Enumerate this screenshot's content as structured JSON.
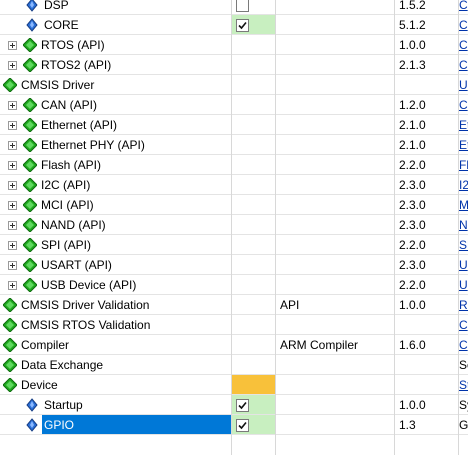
{
  "rows": [
    {
      "id": "dsp",
      "name": "DSP",
      "indent": 2,
      "icon": "component",
      "expander": false,
      "sel": "checkbox-off",
      "variant": "",
      "version": "1.5.2",
      "desc": "C",
      "link": true
    },
    {
      "id": "core",
      "name": "CORE",
      "indent": 2,
      "icon": "component",
      "expander": false,
      "sel": "checkbox-on-green",
      "variant": "",
      "version": "5.1.2",
      "desc": "C",
      "link": true
    },
    {
      "id": "rtos-api",
      "name": "RTOS (API)",
      "indent": 1,
      "icon": "api",
      "expander": true,
      "sel": "",
      "variant": "",
      "version": "1.0.0",
      "desc": "C",
      "link": true
    },
    {
      "id": "rtos2-api",
      "name": "RTOS2 (API)",
      "indent": 1,
      "icon": "api",
      "expander": true,
      "sel": "",
      "variant": "",
      "version": "2.1.3",
      "desc": "C",
      "link": true
    },
    {
      "id": "cmsis-driver",
      "name": "CMSIS Driver",
      "indent": 0,
      "icon": "group",
      "expander": false,
      "sel": "",
      "variant": "",
      "version": "",
      "desc": "U",
      "link": true
    },
    {
      "id": "can-api",
      "name": "CAN (API)",
      "indent": 1,
      "icon": "api",
      "expander": true,
      "sel": "",
      "variant": "",
      "version": "1.2.0",
      "desc": "C",
      "link": true
    },
    {
      "id": "ethernet-api",
      "name": "Ethernet (API)",
      "indent": 1,
      "icon": "api",
      "expander": true,
      "sel": "",
      "variant": "",
      "version": "2.1.0",
      "desc": "Et",
      "link": true
    },
    {
      "id": "ethernet-phy-api",
      "name": "Ethernet PHY (API)",
      "indent": 1,
      "icon": "api",
      "expander": true,
      "sel": "",
      "variant": "",
      "version": "2.1.0",
      "desc": "Et",
      "link": true
    },
    {
      "id": "flash-api",
      "name": "Flash (API)",
      "indent": 1,
      "icon": "api",
      "expander": true,
      "sel": "",
      "variant": "",
      "version": "2.2.0",
      "desc": "Fl",
      "link": true
    },
    {
      "id": "i2c-api",
      "name": "I2C (API)",
      "indent": 1,
      "icon": "api",
      "expander": true,
      "sel": "",
      "variant": "",
      "version": "2.3.0",
      "desc": "I2",
      "link": true
    },
    {
      "id": "mci-api",
      "name": "MCI (API)",
      "indent": 1,
      "icon": "api",
      "expander": true,
      "sel": "",
      "variant": "",
      "version": "2.3.0",
      "desc": "M",
      "link": true
    },
    {
      "id": "nand-api",
      "name": "NAND (API)",
      "indent": 1,
      "icon": "api",
      "expander": true,
      "sel": "",
      "variant": "",
      "version": "2.3.0",
      "desc": "N",
      "link": true
    },
    {
      "id": "spi-api",
      "name": "SPI (API)",
      "indent": 1,
      "icon": "api",
      "expander": true,
      "sel": "",
      "variant": "",
      "version": "2.2.0",
      "desc": "SP",
      "link": true
    },
    {
      "id": "usart-api",
      "name": "USART (API)",
      "indent": 1,
      "icon": "api",
      "expander": true,
      "sel": "",
      "variant": "",
      "version": "2.3.0",
      "desc": "U",
      "link": true
    },
    {
      "id": "usb-device-api",
      "name": "USB Device (API)",
      "indent": 1,
      "icon": "api",
      "expander": true,
      "sel": "",
      "variant": "",
      "version": "2.2.0",
      "desc": "U",
      "link": true
    },
    {
      "id": "cmsis-driver-validation",
      "name": "CMSIS Driver Validation",
      "indent": 0,
      "icon": "group",
      "expander": false,
      "sel": "",
      "variant": "API",
      "version": "1.0.0",
      "desc": "Re",
      "link": true
    },
    {
      "id": "cmsis-rtos-validation",
      "name": "CMSIS RTOS Validation",
      "indent": 0,
      "icon": "group",
      "expander": false,
      "sel": "",
      "variant": "",
      "version": "",
      "desc": "C",
      "link": true
    },
    {
      "id": "compiler",
      "name": "Compiler",
      "indent": 0,
      "icon": "group",
      "expander": false,
      "sel": "",
      "variant": "ARM Compiler",
      "version": "1.6.0",
      "desc": "C",
      "link": true
    },
    {
      "id": "data-exchange",
      "name": "Data Exchange",
      "indent": 0,
      "icon": "group",
      "expander": false,
      "sel": "",
      "variant": "",
      "version": "",
      "desc": "So",
      "link": false
    },
    {
      "id": "device",
      "name": "Device",
      "indent": 0,
      "icon": "group",
      "expander": false,
      "sel": "orange",
      "variant": "",
      "version": "",
      "desc": "St",
      "link": true
    },
    {
      "id": "startup",
      "name": "Startup",
      "indent": 2,
      "icon": "component",
      "expander": false,
      "sel": "checkbox-on-green",
      "variant": "",
      "version": "1.0.0",
      "desc": "Sy",
      "link": false
    },
    {
      "id": "gpio",
      "name": "GPIO",
      "indent": 2,
      "icon": "component",
      "expander": false,
      "sel": "checkbox-on-green",
      "variant": "",
      "version": "1.3",
      "desc": "G",
      "link": false,
      "selected": true
    }
  ]
}
